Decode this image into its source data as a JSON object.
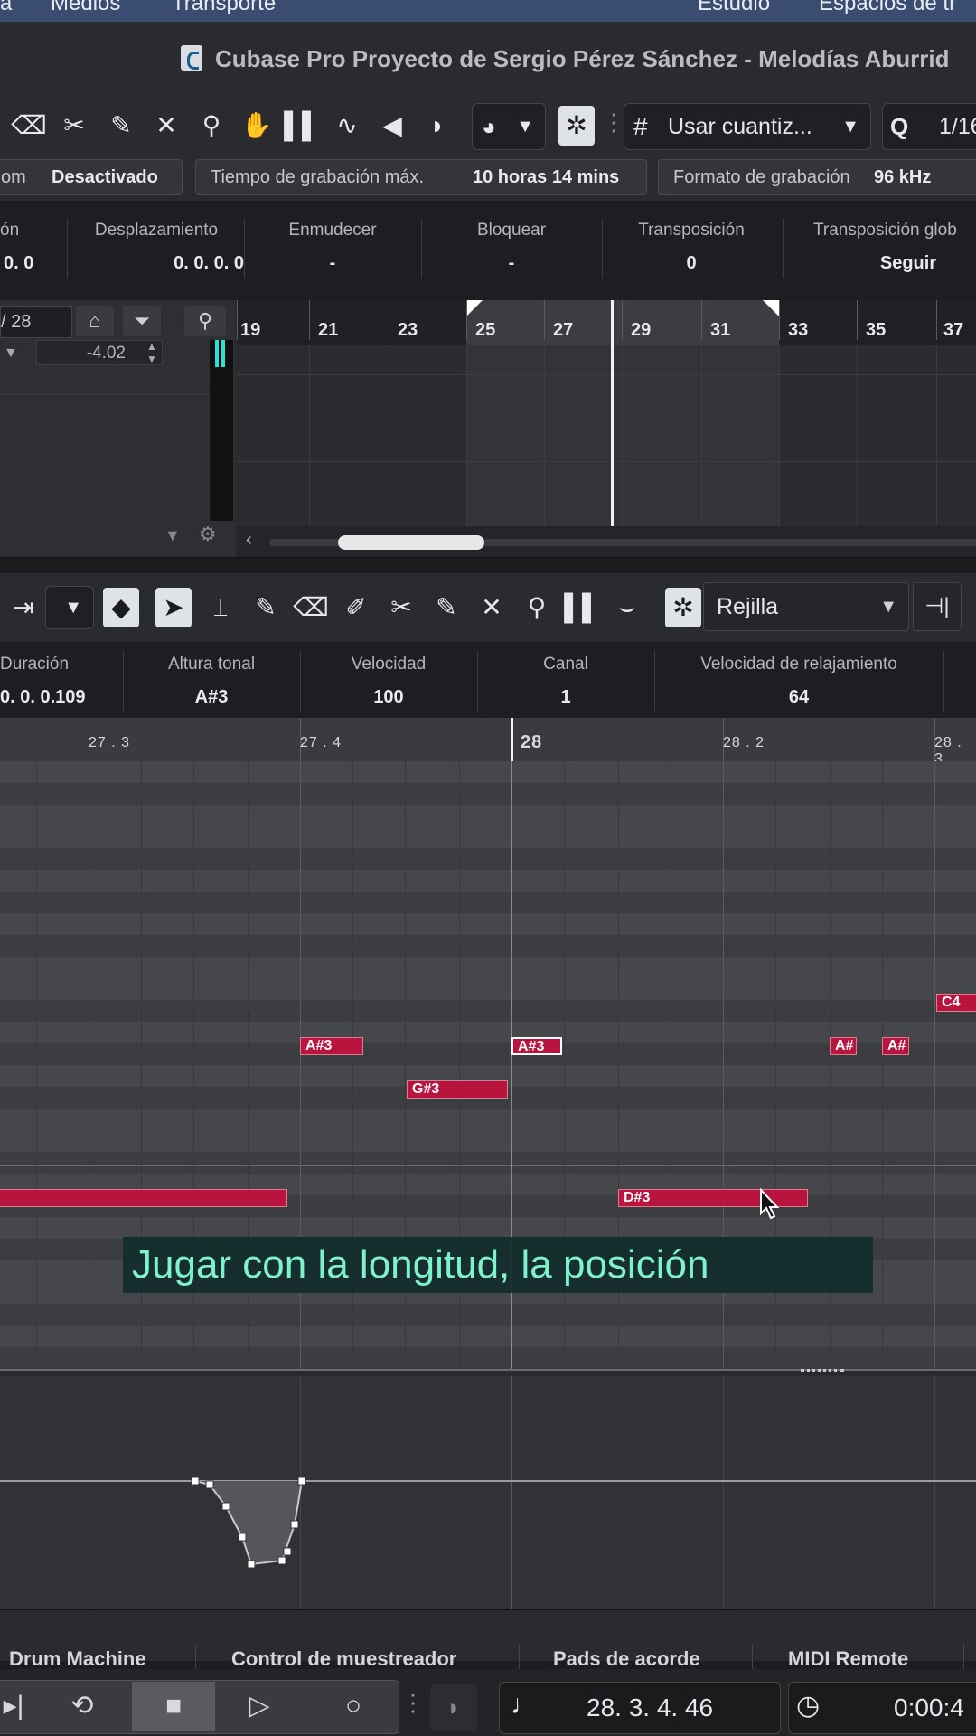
{
  "menubar": {
    "items": [
      "a",
      "Medios",
      "Transporte",
      "Estudio",
      "Espacios de tr"
    ]
  },
  "window": {
    "title": "Cubase Pro Proyecto de Sergio Pérez Sánchez - Melodías Aburrid"
  },
  "toolbar": {
    "tools": [
      "eraser-icon",
      "scissors-icon",
      "glue-icon",
      "mute-x-icon",
      "zoom-icon",
      "hand-icon",
      "comp-icon",
      "warp-icon",
      "mute-icon",
      "color-icon"
    ],
    "mode_icon": "speech-icon",
    "snap_label": "Usar cuantiz...",
    "quantize_value": "1/16"
  },
  "infobar": {
    "item1_label": "om",
    "item1_value": "Desactivado",
    "rec_time_label": "Tiempo de grabación máx.",
    "rec_time_value": "10 horas 14 mins",
    "rec_format_label": "Formato de grabación",
    "rec_format_value": "96 kHz"
  },
  "event_info": {
    "col0_header": "ón",
    "col0_value": "0.   0",
    "offset_header": "Desplazamiento",
    "offset_value": "0.   0.   0.   0",
    "mute_header": "Enmudecer",
    "mute_value": "-",
    "lock_header": "Bloquear",
    "lock_value": "-",
    "transpose_header": "Transposición",
    "transpose_value": "0",
    "global_transpose_header": "Transposición glob",
    "global_transpose_value": "Seguir"
  },
  "project": {
    "track_counter": "/ 28",
    "volume_value": "-4.02",
    "ruler": [
      "19",
      "21",
      "23",
      "25",
      "27",
      "29",
      "31",
      "33",
      "35",
      "37"
    ]
  },
  "editor_toolbar": {
    "grid_label": "Rejilla"
  },
  "note_info": {
    "duration_header": "Duración",
    "duration_value": "0.   0.   0.109",
    "pitch_header": "Altura tonal",
    "pitch_value": "A#3",
    "velocity_header": "Velocidad",
    "velocity_value": "100",
    "channel_header": "Canal",
    "channel_value": "1",
    "release_header": "Velocidad de relajamiento",
    "release_value": "64"
  },
  "piano_roll": {
    "ruler": [
      "27 . 3",
      "27 . 4",
      "28",
      "28 . 2",
      "28 . 3"
    ],
    "notes": [
      "A#3",
      "A#3",
      "G#3",
      "A#",
      "A#",
      "C4",
      "D#3"
    ]
  },
  "subtitle": "Jugar con la longitud, la posición",
  "bottom_tabs": [
    "Drum Machine",
    "Control de muestreador",
    "Pads de acorde",
    "MIDI Remote"
  ],
  "transport": {
    "position": "28.   3.   4.   46",
    "time": "0:00:4"
  },
  "colors": {
    "note": "#b8143e",
    "subtitle_text": "#7ff2c9",
    "menubar": "#3a4d70"
  }
}
